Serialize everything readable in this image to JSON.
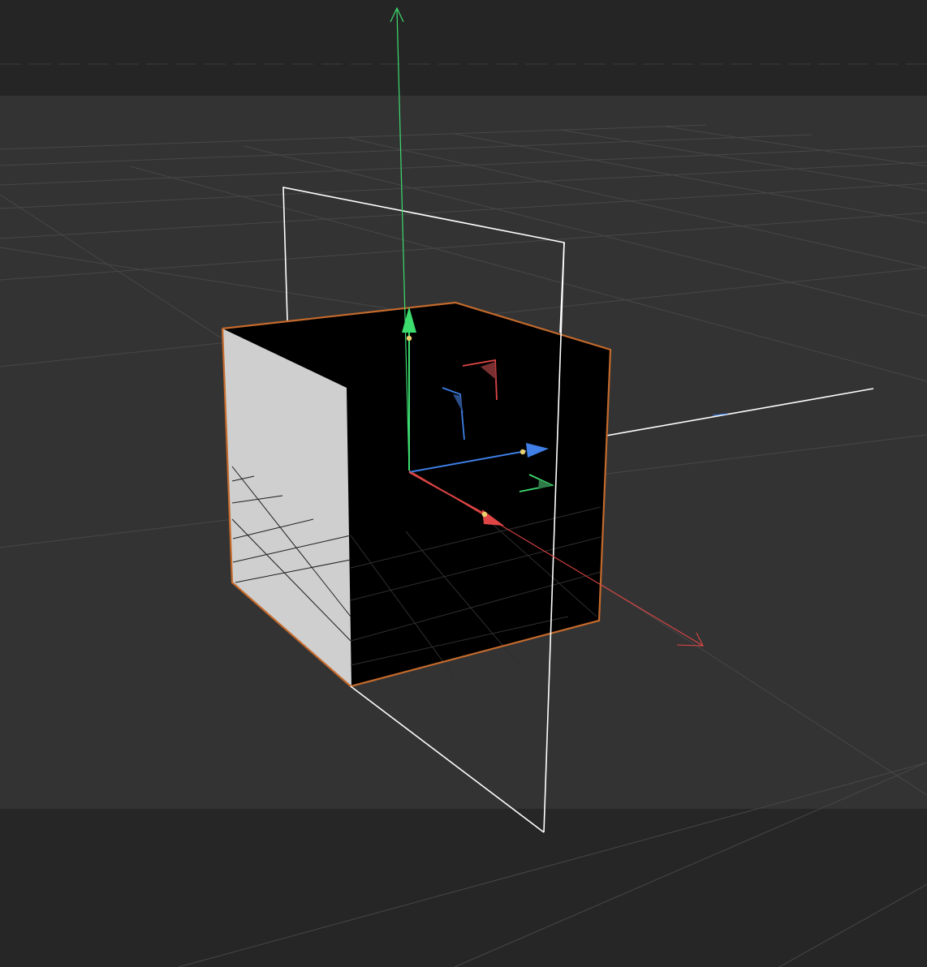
{
  "viewport": {
    "colors": {
      "background_top": "#252525",
      "background_middle": "#333333",
      "background_bottom": "#262626",
      "floor_grid": "#4a4a4a",
      "selection_outline": "#c46a2c",
      "x_axis": "#e04545",
      "y_axis": "#3ddc6f",
      "z_axis": "#3f7fe6",
      "guide_plane": "#ffffff",
      "face_dark": "#000000",
      "face_light": "#cfcfcf",
      "pivot": "#e8d070"
    },
    "objects": {
      "cube": {
        "name": "cube",
        "selected": true
      }
    },
    "gizmo": {
      "type": "move-gizmo",
      "axes": [
        "x",
        "y",
        "z"
      ],
      "plane_handles": [
        "xy",
        "yz",
        "xz"
      ]
    }
  }
}
